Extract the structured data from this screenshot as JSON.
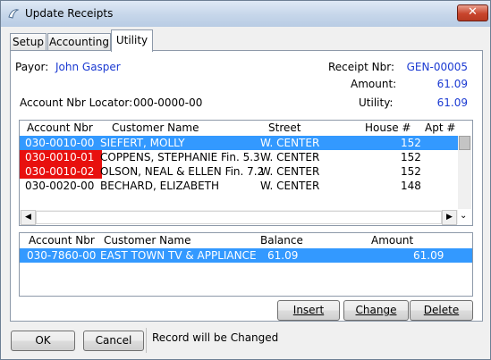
{
  "window": {
    "title": "Update Receipts",
    "close_glyph": "✕"
  },
  "tabs": [
    {
      "label": "Setup"
    },
    {
      "label": "Accounting"
    },
    {
      "label": "Utility"
    }
  ],
  "payor": {
    "label": "Payor:",
    "value": "John Gasper"
  },
  "receipt": {
    "label": "Receipt Nbr:",
    "value": "GEN-00005"
  },
  "amount": {
    "label": "Amount:",
    "value": "61.09"
  },
  "utility": {
    "label": "Utility:",
    "value": "61.09"
  },
  "locator": {
    "label": "Account Nbr Locator:",
    "value": "000-0000-00"
  },
  "accounts_grid": {
    "headers": [
      "Account Nbr",
      "Customer Name",
      "Street",
      "House #",
      "Apt #"
    ],
    "rows": [
      {
        "acct": "030-0010-00",
        "name": "SIEFERT, MOLLY",
        "street": "W. CENTER",
        "house": "152",
        "selected": true,
        "red": false
      },
      {
        "acct": "030-0010-01",
        "name": "COPPENS, STEPHANIE Fin. 5.3",
        "street": "W. CENTER",
        "house": "152",
        "selected": false,
        "red": true
      },
      {
        "acct": "030-0010-02",
        "name": "OLSON, NEAL & ELLEN Fin. 7.2",
        "street": "W. CENTER",
        "house": "152",
        "selected": false,
        "red": true
      },
      {
        "acct": "030-0020-00",
        "name": "BECHARD, ELIZABETH",
        "street": "W. CENTER",
        "house": "148",
        "selected": false,
        "red": false
      }
    ]
  },
  "payments_grid": {
    "headers": [
      "Account Nbr",
      "Customer Name",
      "Balance",
      "Amount"
    ],
    "rows": [
      {
        "acct": "030-7860-00",
        "name": "EAST TOWN TV & APPLIANCE",
        "balance": "61.09",
        "amount": "61.09",
        "selected": true
      }
    ]
  },
  "actions": {
    "insert": "Insert",
    "change": "Change",
    "delete": "Delete"
  },
  "footer": {
    "ok": "OK",
    "cancel": "Cancel",
    "status": "Record will be Changed"
  },
  "colors": {
    "selection": "#3399ff",
    "flag_red": "#e8100e",
    "value_blue": "#1b3ad2"
  }
}
